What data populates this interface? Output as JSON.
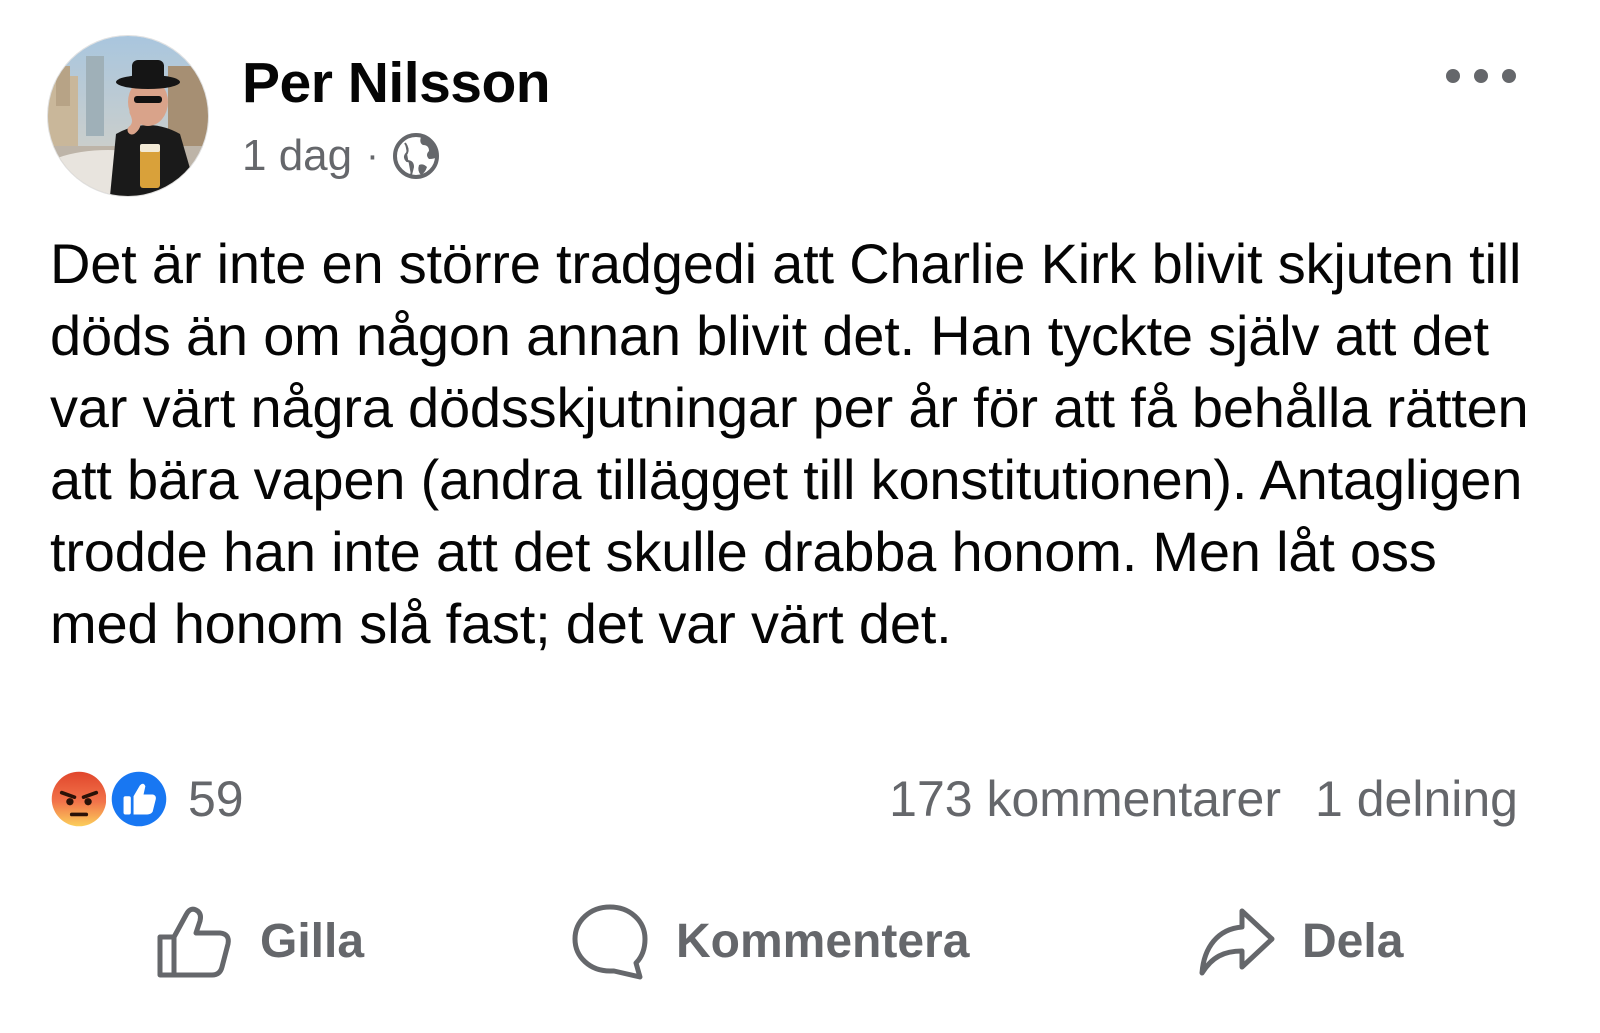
{
  "post": {
    "author": {
      "name": "Per Nilsson",
      "avatar_icon": "profile-photo"
    },
    "timestamp": "1 dag",
    "separator": "·",
    "audience_icon": "globe-icon",
    "more_icon": "more-options-icon",
    "text": "Det är inte en större tradgedi att Charlie Kirk blivit skjuten till döds än om någon annan blivit det. Han tyckte själv att det var värt några dödsskjutningar per år för att få behålla rätten att bära vapen (andra tillägget till konstitutionen). Antagligen trodde han inte att det skulle drabba honom. Men låt oss med honom slå fast; det var värt det."
  },
  "engagement": {
    "reactions": [
      "angry",
      "like"
    ],
    "reaction_count": "59",
    "comments": "173 kommentarer",
    "shares": "1 delning"
  },
  "actions": {
    "like": {
      "label": "Gilla",
      "icon": "thumbs-up-icon"
    },
    "comment": {
      "label": "Kommentera",
      "icon": "comment-icon"
    },
    "share": {
      "label": "Dela",
      "icon": "share-icon"
    }
  },
  "colors": {
    "text": "#050505",
    "secondary": "#65676b",
    "like_blue": "#1877f2",
    "angry_orange": "#f2734a"
  }
}
